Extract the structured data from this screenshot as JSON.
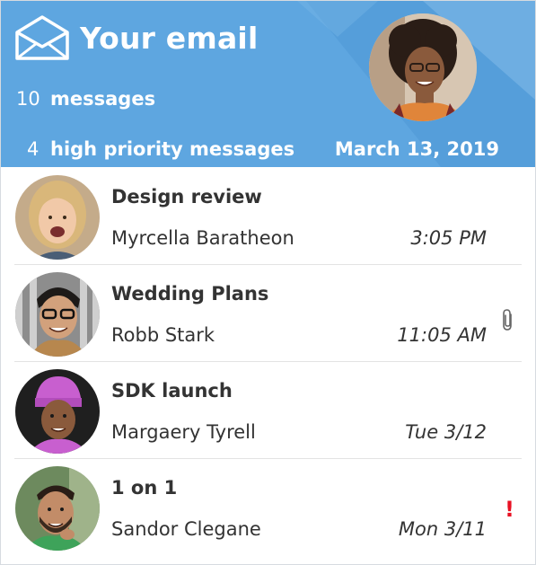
{
  "header": {
    "title": "Your email",
    "message_count": "10",
    "message_label": "messages",
    "priority_count": "4",
    "priority_label": "high priority messages",
    "date": "March 13, 2019",
    "mail_icon": "envelope-open-icon",
    "avatar": "user-avatar"
  },
  "emails": [
    {
      "subject": "Design review",
      "sender": "Myrcella Baratheon",
      "time": "3:05 PM",
      "flag": ""
    },
    {
      "subject": "Wedding Plans",
      "sender": "Robb Stark",
      "time": "11:05 AM",
      "flag": "attachment-icon"
    },
    {
      "subject": "SDK launch",
      "sender": "Margaery Tyrell",
      "time": "Tue 3/12",
      "flag": ""
    },
    {
      "subject": "1 on 1",
      "sender": "Sandor Clegane",
      "time": "Mon 3/11",
      "flag": "high-importance-icon",
      "flag_text": "!"
    }
  ],
  "colors": {
    "header_bg": "#5ea6e0",
    "header_text": "#ffffff",
    "body_text": "#333333",
    "importance": "#e81123",
    "divider": "#e3e3e3"
  }
}
